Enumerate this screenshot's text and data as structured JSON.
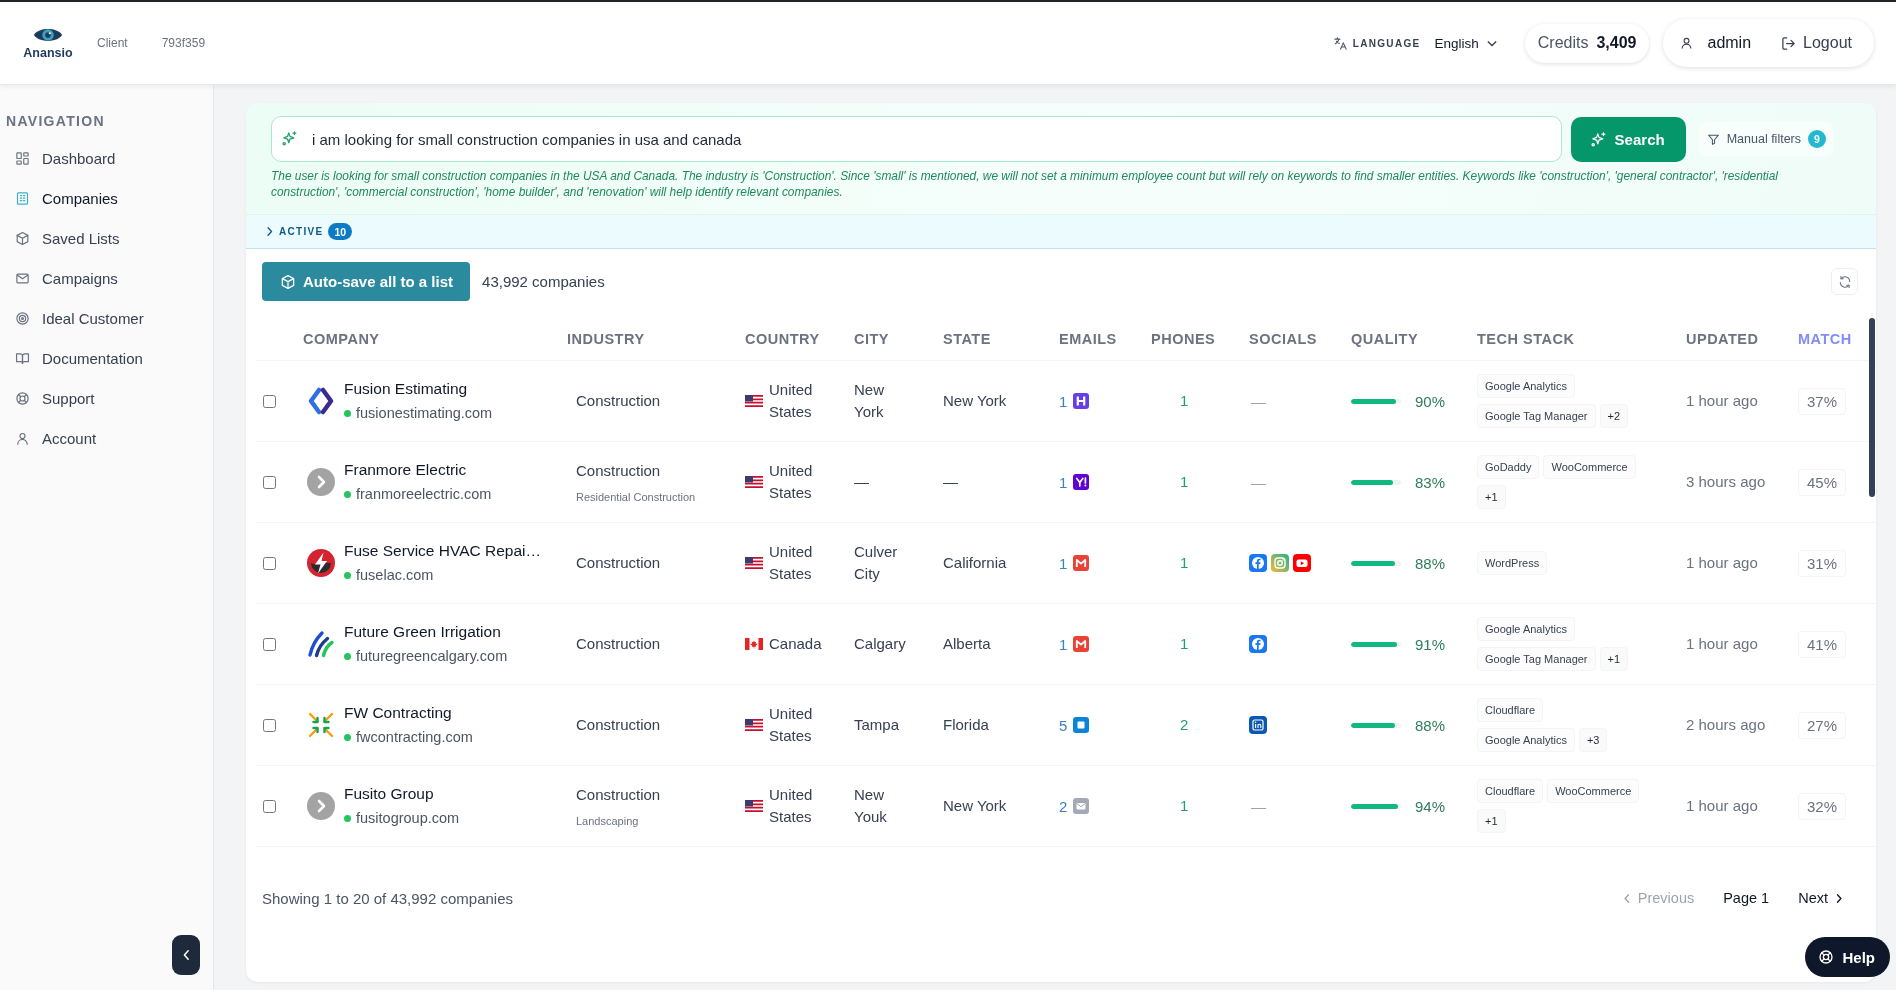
{
  "header": {
    "logo_text": "Anansio",
    "client_label": "Client",
    "client_id": "793f359",
    "language_label": "LANGUAGE",
    "language": "English",
    "credits_label": "Credits",
    "credits": "3,409",
    "user": "admin",
    "logout": "Logout"
  },
  "sidebar": {
    "heading": "NAVIGATION",
    "items": [
      {
        "label": "Dashboard",
        "selected": false
      },
      {
        "label": "Companies",
        "selected": true
      },
      {
        "label": "Saved Lists",
        "selected": false
      },
      {
        "label": "Campaigns",
        "selected": false
      },
      {
        "label": "Ideal Customer",
        "selected": false
      },
      {
        "label": "Documentation",
        "selected": false
      },
      {
        "label": "Support",
        "selected": false
      },
      {
        "label": "Account",
        "selected": false
      }
    ]
  },
  "search": {
    "query": "i am looking for small construction companies in usa and canada",
    "button": "Search",
    "manual_filters": "Manual filters",
    "filter_count": "9",
    "explanation": "The user is looking for small construction companies in the USA and Canada. The industry is 'Construction'. Since 'small' is mentioned, we will not set a minimum employee count but will rely on keywords to find smaller entities. Keywords like 'construction', 'general contractor', 'residential construction', 'commercial construction', 'home builder', and 'renovation' will help identify relevant companies."
  },
  "active_filters": {
    "label": "ACTIVE",
    "count": "10",
    "expanded": false
  },
  "toolbar": {
    "autosave_button": "Auto-save all to a list",
    "total": "43,992 companies"
  },
  "table": {
    "columns": [
      {
        "label": "COMPANY",
        "sorted": false
      },
      {
        "label": "INDUSTRY",
        "sorted": false
      },
      {
        "label": "COUNTRY",
        "sorted": false
      },
      {
        "label": "CITY",
        "sorted": false
      },
      {
        "label": "STATE",
        "sorted": false
      },
      {
        "label": "EMAILS",
        "sorted": false
      },
      {
        "label": "PHONES",
        "sorted": false
      },
      {
        "label": "SOCIALS",
        "sorted": false
      },
      {
        "label": "QUALITY",
        "sorted": false
      },
      {
        "label": "TECH STACK",
        "sorted": false
      },
      {
        "label": "UPDATED",
        "sorted": false
      },
      {
        "label": "MATCH",
        "sorted": true
      }
    ],
    "rows": [
      {
        "selected": false,
        "logo": {
          "kind": "diamond"
        },
        "name": "Fusion Estimating",
        "domain": "fusionestimating.com",
        "domain_live": true,
        "industry": "Construction",
        "country": {
          "kind": "us",
          "name": "United States"
        },
        "city": "New York",
        "state": "New York",
        "emails": {
          "count": "1",
          "kind": "hostinger"
        },
        "phones": "1",
        "socials": [
          {
            "kind": "dash",
            "text": "—"
          }
        ],
        "quality": {
          "level": 0.9,
          "text": "90%"
        },
        "tech_stack": [
          {
            "kind": "tool",
            "text": "Google Analytics"
          },
          {
            "kind": "tool",
            "text": "Google Tag Manager"
          },
          {
            "kind": "more",
            "text": "+2"
          }
        ],
        "updated": "1 hour ago",
        "match": "37%"
      },
      {
        "selected": false,
        "logo": {
          "kind": "placeholder"
        },
        "name": "Franmore Electric",
        "domain": "franmoreelectric.com",
        "domain_live": true,
        "industry": "Construction",
        "sub_industry": "Residential Construction",
        "country": {
          "kind": "us",
          "name": "United States"
        },
        "city": "—",
        "state": "—",
        "emails": {
          "count": "1",
          "kind": "yahoo"
        },
        "phones": "1",
        "socials": [
          {
            "kind": "dash",
            "text": "—"
          }
        ],
        "quality": {
          "level": 0.83,
          "text": "83%"
        },
        "tech_stack": [
          {
            "kind": "tool",
            "text": "GoDaddy"
          },
          {
            "kind": "tool",
            "text": "WooCommerce"
          },
          {
            "kind": "more",
            "text": "+1"
          }
        ],
        "updated": "3 hours ago",
        "match": "45%"
      },
      {
        "selected": false,
        "logo": {
          "kind": "bolt"
        },
        "name": "Fuse Service HVAC Repai…",
        "domain": "fuselac.com",
        "domain_live": true,
        "industry": "Construction",
        "country": {
          "kind": "us",
          "name": "United States"
        },
        "city": "Culver City",
        "state": "California",
        "emails": {
          "count": "1",
          "kind": "gmail"
        },
        "phones": "1",
        "socials": [
          {
            "kind": "facebook"
          },
          {
            "kind": "instagram"
          },
          {
            "kind": "youtube"
          }
        ],
        "quality": {
          "level": 0.88,
          "text": "88%"
        },
        "tech_stack": [
          {
            "kind": "tool",
            "text": "WordPress"
          }
        ],
        "updated": "1 hour ago",
        "match": "31%"
      },
      {
        "selected": false,
        "logo": {
          "kind": "stripes"
        },
        "name": "Future Green Irrigation",
        "domain": "futuregreencalgary.com",
        "domain_live": true,
        "industry": "Construction",
        "country": {
          "kind": "ca",
          "name": "Canada"
        },
        "city": "Calgary",
        "state": "Alberta",
        "emails": {
          "count": "1",
          "kind": "gmail"
        },
        "phones": "1",
        "socials": [
          {
            "kind": "facebook"
          }
        ],
        "quality": {
          "level": 0.91,
          "text": "91%"
        },
        "tech_stack": [
          {
            "kind": "tool",
            "text": "Google Analytics"
          },
          {
            "kind": "tool",
            "text": "Google Tag Manager"
          },
          {
            "kind": "more",
            "text": "+1"
          }
        ],
        "updated": "1 hour ago",
        "match": "41%"
      },
      {
        "selected": false,
        "logo": {
          "kind": "arrows"
        },
        "name": "FW Contracting",
        "domain": "fwcontracting.com",
        "domain_live": true,
        "industry": "Construction",
        "country": {
          "kind": "us",
          "name": "United States"
        },
        "city": "Tampa",
        "state": "Florida",
        "emails": {
          "count": "5",
          "kind": "outlook"
        },
        "phones": "2",
        "socials": [
          {
            "kind": "linkedin"
          }
        ],
        "quality": {
          "level": 0.88,
          "text": "88%"
        },
        "tech_stack": [
          {
            "kind": "tool",
            "text": "Cloudflare"
          },
          {
            "kind": "tool",
            "text": "Google Analytics"
          },
          {
            "kind": "more",
            "text": "+3"
          }
        ],
        "updated": "2 hours ago",
        "match": "27%"
      },
      {
        "selected": false,
        "logo": {
          "kind": "placeholder"
        },
        "name": "Fusito Group",
        "domain": "fusitogroup.com",
        "domain_live": true,
        "industry": "Construction",
        "sub_industry": "Landscaping",
        "country": {
          "kind": "us",
          "name": "United States"
        },
        "city": "New Youk",
        "state": "New York",
        "emails": {
          "count": "2",
          "kind": "generic"
        },
        "phones": "1",
        "socials": [
          {
            "kind": "dash",
            "text": "—"
          }
        ],
        "quality": {
          "level": 0.94,
          "text": "94%"
        },
        "tech_stack": [
          {
            "kind": "tool",
            "text": "Cloudflare"
          },
          {
            "kind": "tool",
            "text": "WooCommerce"
          },
          {
            "kind": "more",
            "text": "+1"
          }
        ],
        "updated": "1 hour ago",
        "match": "32%"
      }
    ]
  },
  "footer": {
    "summary": "Showing 1 to 20 of 43,992 companies",
    "previous": {
      "label": "Previous",
      "disabled": true
    },
    "page": "Page 1",
    "next": {
      "label": "Next",
      "disabled": false
    }
  },
  "help_button": "Help"
}
